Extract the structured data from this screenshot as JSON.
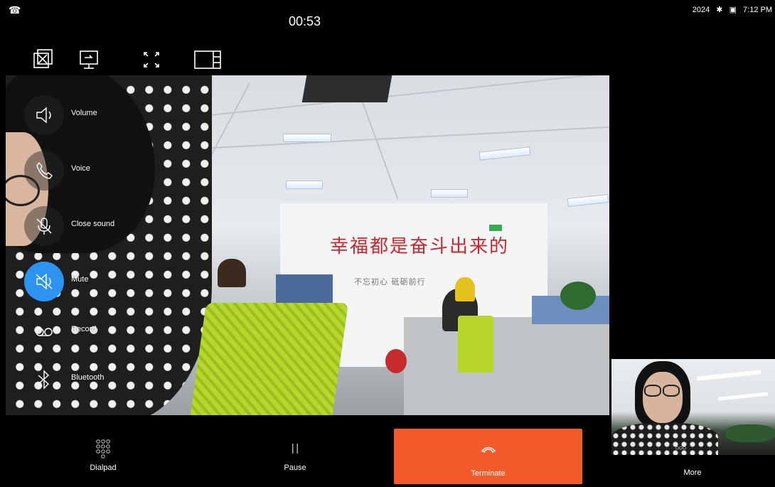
{
  "header": {
    "call_icon": "phone-icon",
    "timer": "00:53"
  },
  "top_tools": [
    {
      "name": "switch-camera-icon"
    },
    {
      "name": "screen-share-icon"
    },
    {
      "name": "fullscreen-icon"
    },
    {
      "name": "layout-icon"
    }
  ],
  "side_controls": [
    {
      "label": "Volume",
      "icon": "volume-icon"
    },
    {
      "label": "Voice",
      "icon": "phone-handset-icon"
    },
    {
      "label": "Close sound",
      "icon": "mic-off-icon"
    },
    {
      "label": "Mute",
      "icon": "speaker-mute-icon",
      "active": true
    },
    {
      "label": "Record",
      "icon": "record-icon"
    },
    {
      "label": "Bluetooth",
      "icon": "bluetooth-icon"
    }
  ],
  "video_scene": {
    "slogan": "幸福都是奋斗出来的",
    "subslogan": "不忘初心 砥砺前行"
  },
  "bottom_bar": {
    "dialpad": "Dialpad",
    "pause": "Pause",
    "terminate": "Terminate",
    "more": "More"
  },
  "status_bar": {
    "year": "2024",
    "time": "7:12 PM"
  },
  "colors": {
    "terminate": "#f25a2a",
    "active_control": "#2d93f0"
  }
}
